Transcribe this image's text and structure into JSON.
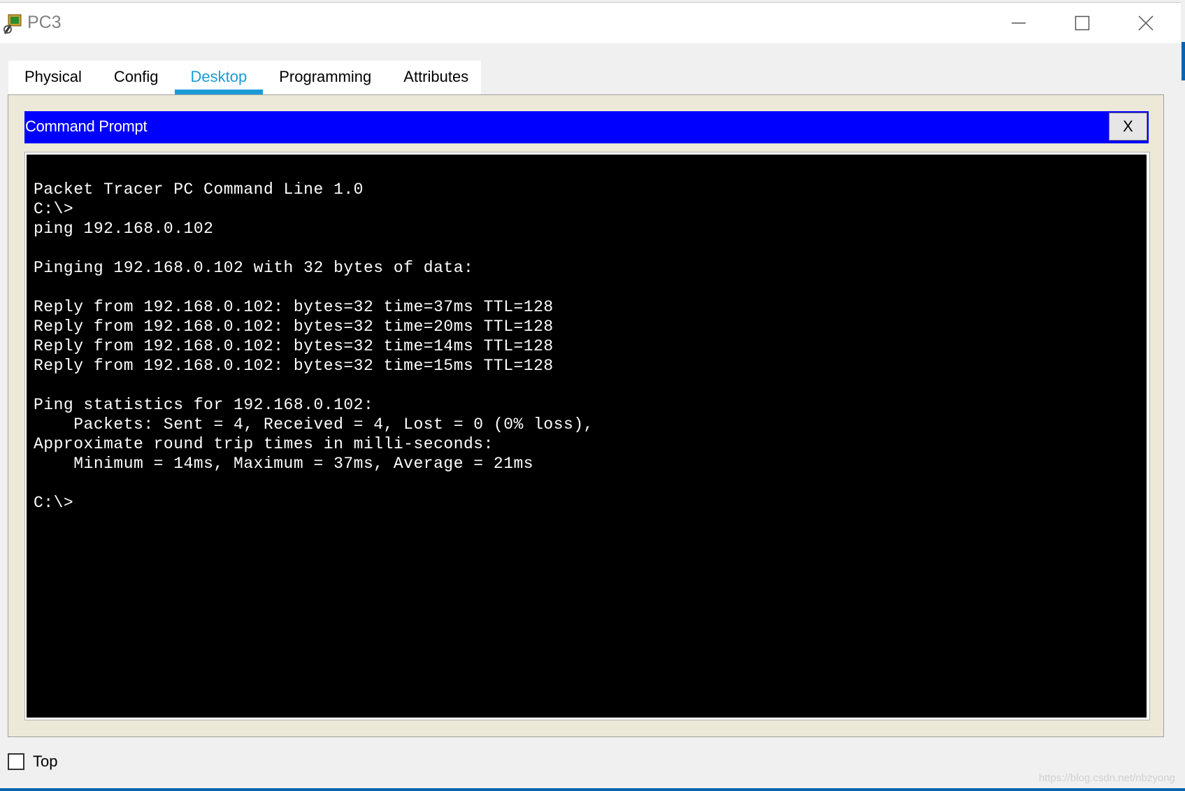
{
  "window": {
    "title": "PC3",
    "minimize_icon": "minimize-icon",
    "maximize_icon": "maximize-icon",
    "close_icon": "close-icon"
  },
  "tabs": [
    {
      "label": "Physical",
      "active": false
    },
    {
      "label": "Config",
      "active": false
    },
    {
      "label": "Desktop",
      "active": true
    },
    {
      "label": "Programming",
      "active": false
    },
    {
      "label": "Attributes",
      "active": false
    }
  ],
  "command_prompt": {
    "title": "Command Prompt",
    "close_label": "X",
    "output": "Packet Tracer PC Command Line 1.0\nC:\\>\nping 192.168.0.102\n\nPinging 192.168.0.102 with 32 bytes of data:\n\nReply from 192.168.0.102: bytes=32 time=37ms TTL=128\nReply from 192.168.0.102: bytes=32 time=20ms TTL=128\nReply from 192.168.0.102: bytes=32 time=14ms TTL=128\nReply from 192.168.0.102: bytes=32 time=15ms TTL=128\n\nPing statistics for 192.168.0.102:\n    Packets: Sent = 4, Received = 4, Lost = 0 (0% loss),\nApproximate round trip times in milli-seconds:\n    Minimum = 14ms, Maximum = 37ms, Average = 21ms\n\nC:\\>"
  },
  "footer": {
    "top_label": "Top",
    "top_checked": false
  },
  "watermark": "https://blog.csdn.net/nbzyong",
  "colors": {
    "cmd_header": "#0000ff",
    "tab_active": "#1a9bd7",
    "terminal_bg": "#000000",
    "panel_bg": "#ece9d8"
  }
}
